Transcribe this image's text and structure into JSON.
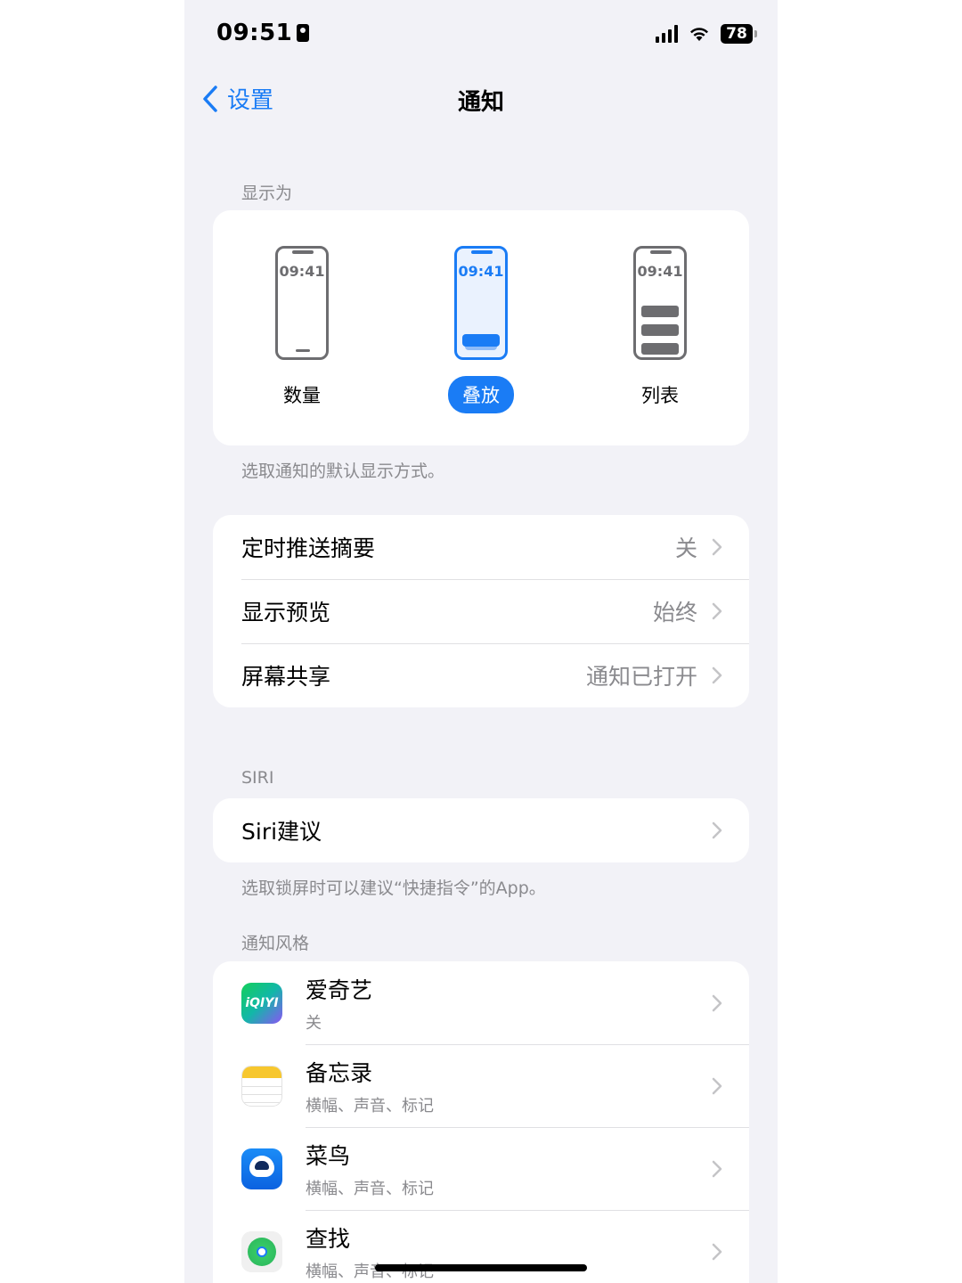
{
  "status": {
    "time": "09:51",
    "battery": "78"
  },
  "nav": {
    "back_label": "设置",
    "title": "通知"
  },
  "display_as": {
    "section_label": "显示为",
    "mini_time": "09:41",
    "options": [
      {
        "label": "数量",
        "selected": false
      },
      {
        "label": "叠放",
        "selected": true
      },
      {
        "label": "列表",
        "selected": false
      }
    ],
    "footnote": "选取通知的默认显示方式。"
  },
  "settings_rows": [
    {
      "label": "定时推送摘要",
      "value": "关"
    },
    {
      "label": "显示预览",
      "value": "始终"
    },
    {
      "label": "屏幕共享",
      "value": "通知已打开"
    }
  ],
  "siri": {
    "section_label": "SIRI",
    "row_label": "Siri建议",
    "footnote": "选取锁屏时可以建议“快捷指令”的App。"
  },
  "notification_style": {
    "section_label": "通知风格",
    "apps": [
      {
        "name": "爱奇艺",
        "sub": "关",
        "icon": "iqiyi-icon",
        "icon_text": "iQIYI"
      },
      {
        "name": "备忘录",
        "sub": "横幅、声音、标记",
        "icon": "notes-icon"
      },
      {
        "name": "菜鸟",
        "sub": "横幅、声音、标记",
        "icon": "cainiao-icon"
      },
      {
        "name": "查找",
        "sub": "横幅、声音、标记",
        "icon": "find-icon"
      }
    ]
  },
  "colors": {
    "accent": "#1a7cf5",
    "background": "#f2f2f7",
    "secondary_text": "#8a8a8e"
  }
}
